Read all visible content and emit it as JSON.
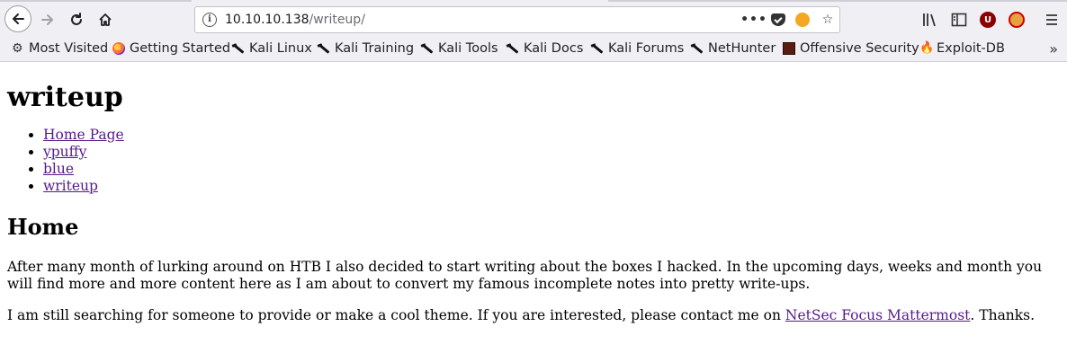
{
  "browser": {
    "url_host": "10.10.10.138",
    "url_path": "/writeup/",
    "bookmarks": [
      {
        "label": "Most Visited",
        "icon": "gear-icon"
      },
      {
        "label": "Getting Started",
        "icon": "firefox-icon"
      },
      {
        "label": "Kali Linux",
        "icon": "kali-dragon-icon"
      },
      {
        "label": "Kali Training",
        "icon": "kali-dragon-icon"
      },
      {
        "label": "Kali Tools",
        "icon": "kali-dragon-icon"
      },
      {
        "label": "Kali Docs",
        "icon": "kali-dragon-icon"
      },
      {
        "label": "Kali Forums",
        "icon": "kali-dragon-icon"
      },
      {
        "label": "NetHunter",
        "icon": "kali-dragon-icon"
      },
      {
        "label": "Offensive Security",
        "icon": "offsec-icon"
      },
      {
        "label": "Exploit-DB",
        "icon": "exploitdb-icon"
      }
    ]
  },
  "page": {
    "title": "writeup",
    "nav": [
      {
        "label": "Home Page"
      },
      {
        "label": "ypuffy"
      },
      {
        "label": "blue"
      },
      {
        "label": "writeup"
      }
    ],
    "section_heading": "Home",
    "paragraph1": "After many month of lurking around on HTB I also decided to start writing about the boxes I hacked. In the upcoming days, weeks and month you will find more and more content here as I am about to convert my famous incomplete notes into pretty write-ups.",
    "paragraph2_before": "I am still searching for someone to provide or make a cool theme. If you are interested, please contact me on ",
    "paragraph2_link": "NetSec Focus Mattermost",
    "paragraph2_after": ". Thanks."
  },
  "colors": {
    "link": "#551a8b",
    "toolbar_bg": "#f0f0f4"
  }
}
